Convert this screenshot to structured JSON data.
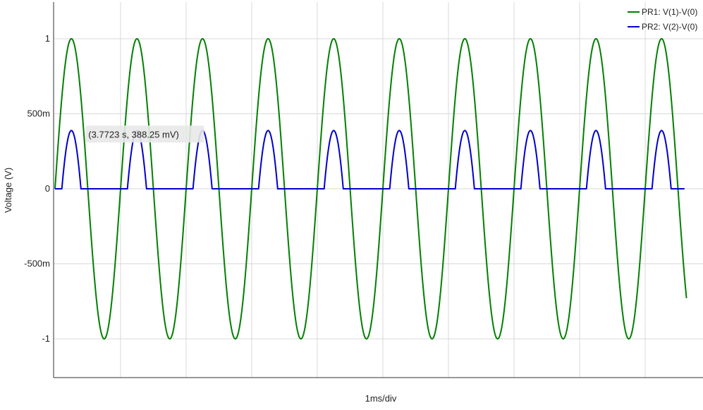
{
  "chart_data": {
    "type": "line",
    "xlabel": "1ms/div",
    "ylabel": "Voltage (V)",
    "ylim": [
      -1.25,
      1.25
    ],
    "xlim": [
      0,
      0.01
    ],
    "x_unit": "s",
    "grid": true,
    "legend_position": "top-right",
    "y_ticks": [
      {
        "value": 1,
        "label": "1"
      },
      {
        "value": 0.5,
        "label": "500m"
      },
      {
        "value": 0,
        "label": "0"
      },
      {
        "value": -0.5,
        "label": "-500m"
      },
      {
        "value": -1,
        "label": "-1"
      }
    ],
    "x_divisions": 10,
    "x_div": 0.001,
    "series": [
      {
        "name": "PR1: V(1)-V(0)",
        "color": "#008000",
        "waveform": "sine",
        "amplitude": 1,
        "period": 0.001,
        "x_end": 0.00963
      },
      {
        "name": "PR2: V(2)-V(0)",
        "color": "#0000cc",
        "waveform": "rectified-sine-peaks",
        "peak": 0.38825,
        "threshold": 0.61,
        "period": 0.001,
        "x_end": 0.0096
      }
    ],
    "annotations": [
      {
        "text": "(3.7723 s, 388.25 mV)",
        "x": 0.00025,
        "y": 0.38825
      }
    ]
  }
}
